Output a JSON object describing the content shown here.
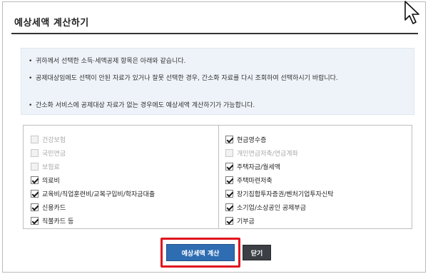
{
  "dialog": {
    "title": "예상세액 계산하기"
  },
  "notices": [
    {
      "bullet": "•",
      "text": "귀하께서 선택한 소득·세액공제 항목은 아래와 같습니다."
    },
    {
      "bullet": "•",
      "text": "공제대상임에도 선택이 안된 자료가 있거나 잘못 선택한 경우, 간소화 자료를 다시 조회하여 선택하시기 바랍니다."
    },
    {
      "bullet": "•",
      "text": "간소화 서비스에 공제대상 자료가 없는 경우에도 예상세액 계산하기가 가능합니다."
    }
  ],
  "options": {
    "left": [
      {
        "label": "건강보험",
        "checked": false,
        "disabled": true
      },
      {
        "label": "국민연금",
        "checked": false,
        "disabled": true
      },
      {
        "label": "보험료",
        "checked": false,
        "disabled": true
      },
      {
        "label": "의료비",
        "checked": true,
        "disabled": false
      },
      {
        "label": "교육비/직업훈련비/교복구입비/학자금대출",
        "checked": true,
        "disabled": false
      },
      {
        "label": "신용카드",
        "checked": true,
        "disabled": false
      },
      {
        "label": "직불카드 등",
        "checked": true,
        "disabled": false
      }
    ],
    "right": [
      {
        "label": "현금영수증",
        "checked": true,
        "disabled": false
      },
      {
        "label": "개인연금저축/연금계좌",
        "checked": false,
        "disabled": true
      },
      {
        "label": "주택자금/월세액",
        "checked": true,
        "disabled": false
      },
      {
        "label": "주택마련저축",
        "checked": true,
        "disabled": false
      },
      {
        "label": "장기집합투자증권/벤처기업투자신탁",
        "checked": true,
        "disabled": false
      },
      {
        "label": "소기업/소상공인 공제부금",
        "checked": true,
        "disabled": false
      },
      {
        "label": "기부금",
        "checked": true,
        "disabled": false
      }
    ]
  },
  "buttons": {
    "calculate_label": "예상세액 계산",
    "close_label": "닫기"
  },
  "colors": {
    "primary_button": "#2f6db3",
    "close_button": "#3c3f45",
    "highlight": "#e0141e",
    "info_background": "#eef3f9"
  }
}
